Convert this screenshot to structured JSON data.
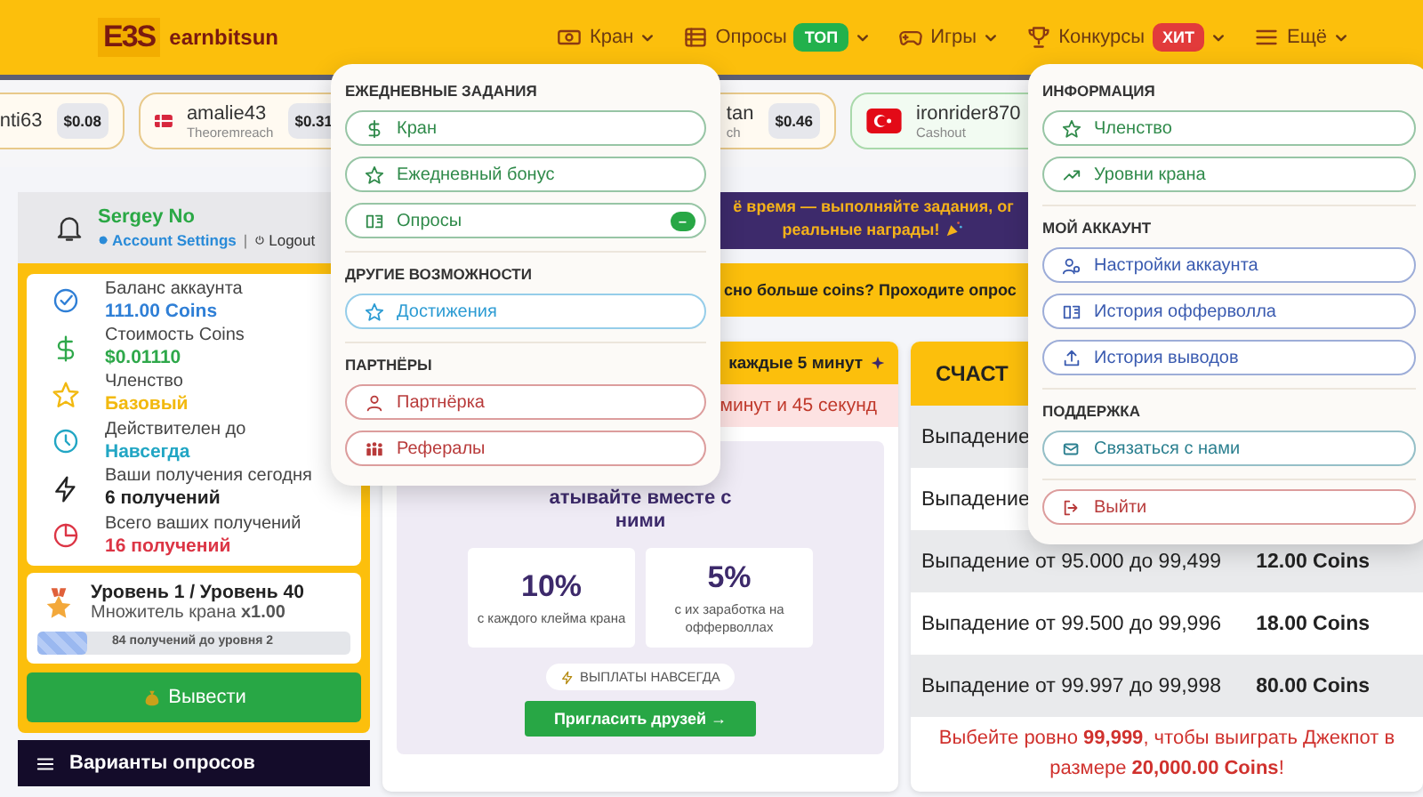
{
  "header": {
    "logo_mark": "E3S",
    "logo_text": "earnbitsun",
    "nav": [
      {
        "label": "Кран",
        "kind": "cash"
      },
      {
        "label": "Опросы",
        "kind": "list",
        "badge": {
          "text": "ТОП",
          "color": "#22b14c"
        }
      },
      {
        "label": "Игры",
        "kind": "gamepad"
      },
      {
        "label": "Конкурсы",
        "kind": "trophy",
        "badge": {
          "text": "ХИТ",
          "color": "#e23b3b"
        }
      },
      {
        "label": "Ещё",
        "kind": "menu"
      }
    ]
  },
  "ticker": [
    {
      "name": "nti63",
      "amount": "$0.08",
      "color": "#e8c98a"
    },
    {
      "kind": "dk",
      "name": "amalie43",
      "source": "Theoremreach",
      "amount": "$0.31",
      "color": "#e8c98a"
    },
    {
      "name": "tan",
      "source": "ch",
      "amount": "$0.46",
      "color": "#e8c98a"
    },
    {
      "kind": "tr",
      "name": "ironrider870",
      "source": "Cashout",
      "color": "#a9d9ab"
    }
  ],
  "menus": [
    {
      "sections": [
        {
          "title": "ЕЖЕДНЕВНЫЕ ЗАДАНИЯ",
          "items": [
            {
              "label": "Кран",
              "kind": "dollar",
              "color": "#2f8a4a"
            },
            {
              "label": "Ежедневный бонус",
              "kind": "star",
              "color": "#2f8a4a"
            },
            {
              "label": "Опросы",
              "kind": "book",
              "color": "#2f8a4a",
              "badge": "–"
            }
          ]
        },
        {
          "title": "ДРУГИЕ ВОЗМОЖНОСТИ",
          "items": [
            {
              "label": "Достижения",
              "kind": "star",
              "color": "#2b9bd3"
            }
          ]
        },
        {
          "title": "ПАРТНЁРЫ",
          "items": [
            {
              "label": "Партнёрка",
              "kind": "user",
              "color": "#b83a3a"
            },
            {
              "label": "Рефералы",
              "kind": "group",
              "color": "#b83a3a"
            }
          ]
        }
      ]
    },
    {
      "sections": [
        {
          "title": "ИНФОРМАЦИЯ",
          "items": [
            {
              "label": "Членство",
              "kind": "star",
              "color": "#2f8a4a"
            },
            {
              "label": "Уровни крана",
              "kind": "trend",
              "color": "#2f8a4a"
            }
          ]
        },
        {
          "title": "МОЙ АККАУНТ",
          "items": [
            {
              "label": "Настройки аккаунта",
              "kind": "usercog",
              "color": "#3a5bb0"
            },
            {
              "label": "История офферволла",
              "kind": "book",
              "color": "#3a5bb0"
            },
            {
              "label": "История выводов",
              "kind": "upload",
              "color": "#3a5bb0"
            }
          ]
        },
        {
          "title": "ПОДДЕРЖКА",
          "items": [
            {
              "label": "Связаться с нами",
              "kind": "mail",
              "color": "#2a7f8f"
            }
          ]
        },
        {
          "items": [
            {
              "label": "Выйти",
              "kind": "logout",
              "color": "#b83a3a"
            }
          ]
        }
      ]
    }
  ],
  "user": {
    "name": "Sergey No",
    "links": [
      "Account Settings",
      "Logout"
    ],
    "separator": "|"
  },
  "stats": [
    {
      "kind": "check",
      "label": "Баланс аккаунта",
      "value": "111.00 Coins",
      "color": "#2f7fd6"
    },
    {
      "kind": "dollar",
      "label": "Стоимость Coins",
      "value": "$0.01110",
      "color": "#2ea84a"
    },
    {
      "kind": "star",
      "label": "Членство",
      "value": "Базовый",
      "color": "#f2b90f"
    },
    {
      "kind": "clock",
      "label": "Действителен до",
      "value": "Навсегда",
      "color": "#22a6c4"
    },
    {
      "kind": "bolt",
      "label": "Ваши получения сегодня",
      "value": "6 получений",
      "color": "#222222"
    },
    {
      "kind": "pie",
      "label": "Всего ваших получений",
      "value": "16 получений",
      "color": "#dc3545"
    }
  ],
  "level": {
    "title": "Уровень 1 / Уровень 40",
    "multiplier": "Множитель крана **x1.00**",
    "level": 0.16,
    "progress_text": "84 получений до уровня 2"
  },
  "withdraw_button": "Вывести",
  "survey_bar": "Варианты опросов",
  "banner": {
    "lines": [
      "ё время — выполняйте задания, ог",
      "реальные награды!"
    ]
  },
  "promo_strip": "сно больше coins? Проходите опрос",
  "faucet": {
    "title": "каждые 5 минут",
    "timer": "минут и 45 секунд"
  },
  "referral": {
    "title": "атывайте вместе с ними",
    "stats": [
      {
        "value": "10%",
        "caption": "с каждого клейма крана"
      },
      {
        "value": "5%",
        "caption": "с их заработка на офферволлах"
      }
    ],
    "badge": "ВЫПЛАТЫ НАВСЕГДА",
    "button": "Пригласить друзей →"
  },
  "lottery": {
    "title": "СЧАСТ",
    "rows": [
      {
        "range": "Выпадение"
      },
      {
        "range": "Выпадение"
      },
      {
        "range": "Выпадение от 95.000 до 99,499",
        "reward": "12.00 Coins"
      },
      {
        "range": "Выпадение от 99.500 до 99,996",
        "reward": "18.00 Coins"
      },
      {
        "range": "Выпадение от 99.997 до 99,998",
        "reward": "80.00 Coins"
      }
    ],
    "jackpot": "Выбейте ровно **99,999**, чтобы выиграть Джекпот в размере **20,000.00 Coins**!"
  }
}
